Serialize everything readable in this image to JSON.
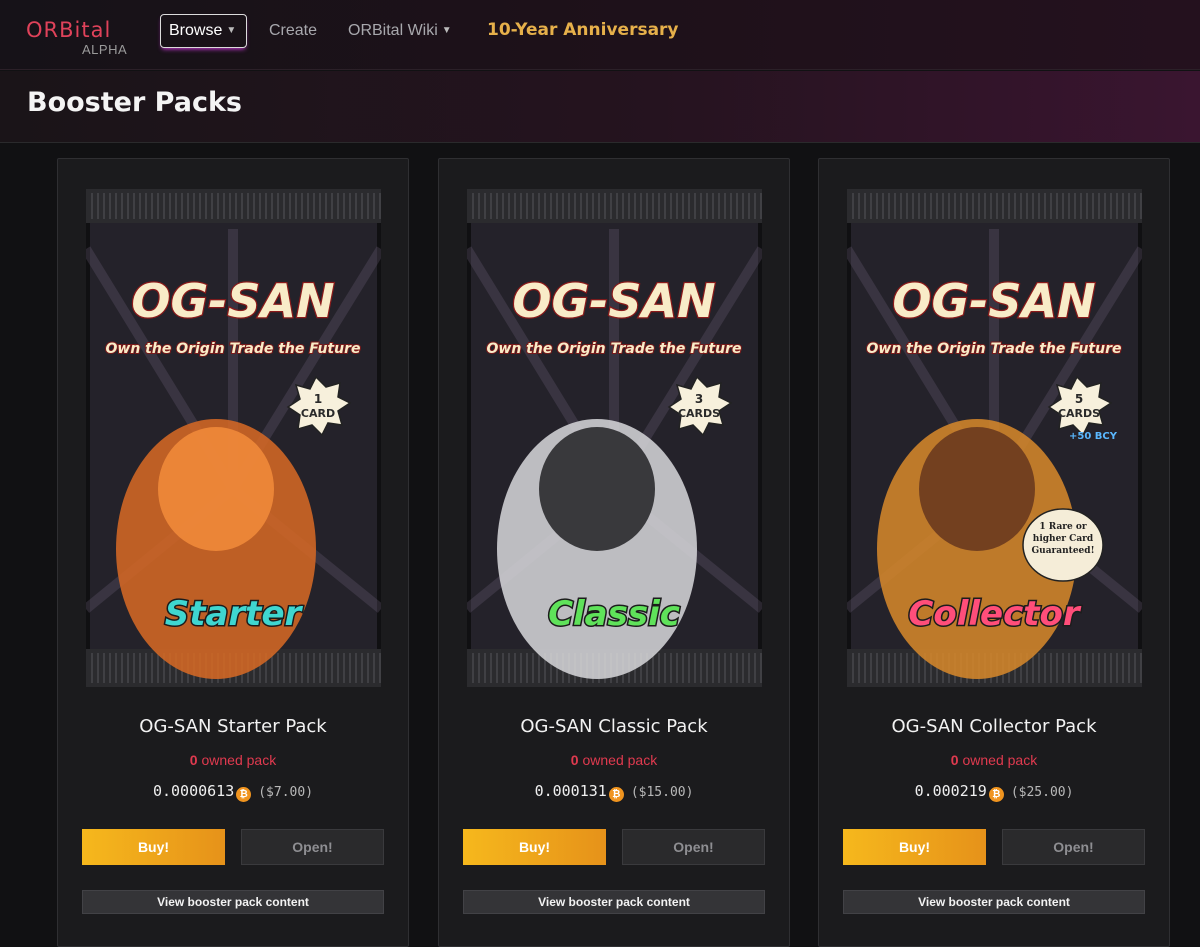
{
  "nav": {
    "logo_main": "ORBital",
    "logo_sub": "ALPHA",
    "browse": "Browse",
    "create": "Create",
    "wiki": "ORBital Wiki",
    "anniversary": "10-Year Anniversary"
  },
  "page": {
    "title": "Booster Packs"
  },
  "packs": [
    {
      "art_brand": "OG-SAN",
      "art_tagline": "Own the Origin  Trade the Future",
      "art_badge_line1": "1",
      "art_badge_line2": "CARD",
      "art_badge_extra": "",
      "art_label": "Starter",
      "art_guarantee": "",
      "name": "OG-SAN Starter Pack",
      "owned_count": "0",
      "owned_label": "owned pack",
      "price_btc": "0.0000613",
      "price_usd": "($7.00)",
      "buy": "Buy!",
      "open": "Open!",
      "view": "View booster pack content",
      "label_color": "#3fd6d0"
    },
    {
      "art_brand": "OG-SAN",
      "art_tagline": "Own the Origin  Trade the Future",
      "art_badge_line1": "3",
      "art_badge_line2": "CARDS",
      "art_badge_extra": "",
      "art_label": "Classic",
      "art_guarantee": "",
      "name": "OG-SAN Classic Pack",
      "owned_count": "0",
      "owned_label": "owned pack",
      "price_btc": "0.000131",
      "price_usd": "($15.00)",
      "buy": "Buy!",
      "open": "Open!",
      "view": "View booster pack content",
      "label_color": "#5fe25a"
    },
    {
      "art_brand": "OG-SAN",
      "art_tagline": "Own the Origin  Trade the Future",
      "art_badge_line1": "5",
      "art_badge_line2": "CARDS",
      "art_badge_extra": "+50 BCY",
      "art_label": "Collector",
      "art_guarantee": "1 Rare or higher Card Guaranteed!",
      "name": "OG-SAN Collector Pack",
      "owned_count": "0",
      "owned_label": "owned pack",
      "price_btc": "0.000219",
      "price_usd": "($25.00)",
      "buy": "Buy!",
      "open": "Open!",
      "view": "View booster pack content",
      "label_color": "#ff4e7a"
    }
  ],
  "icons": {
    "bitcoin": "bitcoin-icon",
    "chevron": "chevron-down-icon"
  },
  "colors": {
    "accent": "#e0425a",
    "buy": "#f6b81c",
    "anniversary": "#e6b04a"
  }
}
